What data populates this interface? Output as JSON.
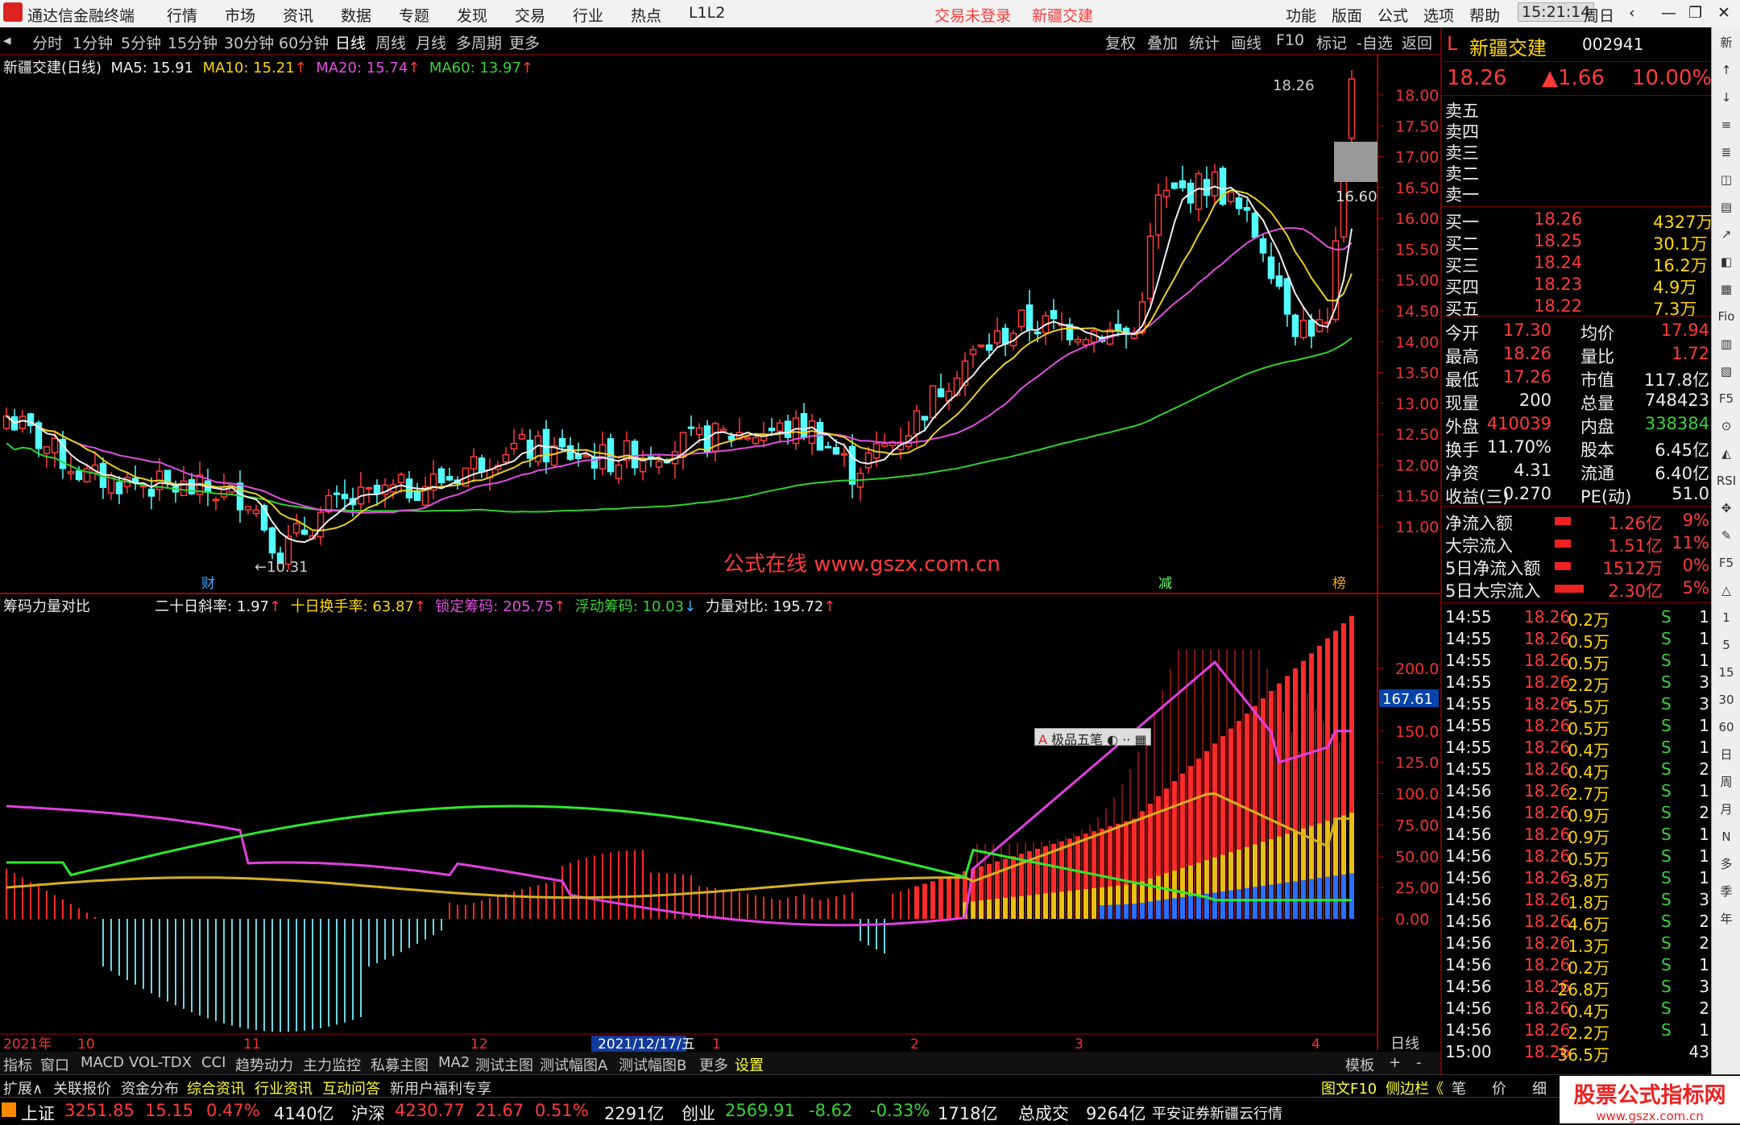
{
  "app": {
    "title": "通达信金融终端",
    "menus": [
      "行情",
      "市场",
      "资讯",
      "数据",
      "专题",
      "发现",
      "交易",
      "行业",
      "热点",
      "L1L2"
    ],
    "notice": [
      "交易未登录",
      "新疆交建"
    ],
    "right_menus": [
      "功能",
      "版面",
      "公式",
      "选项",
      "帮助"
    ],
    "time": "15:21:14",
    "weekday": "周日"
  },
  "periods": [
    "分时",
    "1分钟",
    "5分钟",
    "15分钟",
    "30分钟",
    "60分钟",
    "日线",
    "周线",
    "月线",
    "多周期",
    "更多"
  ],
  "tools": [
    "复权",
    "叠加",
    "统计",
    "画线",
    "F10",
    "标记",
    "-自选",
    "返回"
  ],
  "main_legend": {
    "name": "新疆交建(日线)",
    "ma5": "MA5: 15.91",
    "ma10": "MA10: 15.21",
    "ma20": "MA20: 15.74",
    "ma60": "MA60: 13.97"
  },
  "price_axis": [
    "18.00",
    "17.50",
    "17.00",
    "16.50",
    "16.00",
    "15.50",
    "15.00",
    "14.50",
    "14.00",
    "13.50",
    "13.00",
    "12.50",
    "12.00",
    "11.50",
    "11.00"
  ],
  "annotations": {
    "high": "18.26",
    "low": "10.31",
    "last_box": "16.60",
    "cai": "财",
    "jian": "减",
    "bang": "榜"
  },
  "watermark": "公式在线  www.gszx.com.cn",
  "sub_legend": {
    "name": "筹码力量对比",
    "k1": "二十日斜率: 1.97",
    "k2": "十日换手率: 63.87",
    "k3": "锁定筹码: 205.75",
    "k4": "浮动筹码: 10.03",
    "k5": "力量对比: 195.72"
  },
  "sub_axis": [
    "200.0",
    "175.0",
    "150.0",
    "125.0",
    "100.0",
    "75.00",
    "50.00",
    "25.00",
    "0.00"
  ],
  "sub_cursor": "167.61",
  "ime": "极品五笔",
  "x_axis": [
    "2021年",
    "10",
    "11",
    "12",
    "2021/12/17/五",
    "1",
    "2",
    "3",
    "4"
  ],
  "x_axis_right": "日线",
  "stock": {
    "name": "新疆交建",
    "code": "002941",
    "price": "18.26",
    "change": "▲1.66",
    "pct": "10.00%"
  },
  "asks": [
    "卖五",
    "卖四",
    "卖三",
    "卖二",
    "卖一"
  ],
  "bids": [
    {
      "l": "买一",
      "p": "18.26",
      "v": "4327万"
    },
    {
      "l": "买二",
      "p": "18.25",
      "v": "30.1万"
    },
    {
      "l": "买三",
      "p": "18.24",
      "v": "16.2万"
    },
    {
      "l": "买四",
      "p": "18.23",
      "v": "4.9万"
    },
    {
      "l": "买五",
      "p": "18.22",
      "v": "7.3万"
    }
  ],
  "stats": [
    {
      "a": "今开",
      "b": "17.30",
      "c": "均价",
      "d": "17.94"
    },
    {
      "a": "最高",
      "b": "18.26",
      "c": "量比",
      "d": "1.72"
    },
    {
      "a": "最低",
      "b": "17.26",
      "c": "市值",
      "d": "117.8亿"
    },
    {
      "a": "现量",
      "b": "200",
      "c": "总量",
      "d": "748423"
    },
    {
      "a": "外盘",
      "b": "410039",
      "c": "内盘",
      "d": "338384"
    },
    {
      "a": "换手",
      "b": "11.70%",
      "c": "股本",
      "d": "6.45亿"
    },
    {
      "a": "净资",
      "b": "4.31",
      "c": "流通",
      "d": "6.40亿"
    },
    {
      "a": "收益(三)",
      "b": "0.270",
      "c": "PE(动)",
      "d": "51.0"
    }
  ],
  "flows": [
    {
      "l": "净流入额",
      "v": "1.26亿",
      "p": "9%"
    },
    {
      "l": "大宗流入",
      "v": "1.51亿",
      "p": "11%"
    },
    {
      "l": "5日净流入额",
      "v": "1512万",
      "p": "0%"
    },
    {
      "l": "5日大宗流入",
      "v": "2.30亿",
      "p": "5%"
    }
  ],
  "ticks": [
    [
      "14:55",
      "18.26",
      "0.2万",
      "S",
      "1"
    ],
    [
      "14:55",
      "18.26",
      "0.5万",
      "S",
      "1"
    ],
    [
      "14:55",
      "18.26",
      "0.5万",
      "S",
      "1"
    ],
    [
      "14:55",
      "18.26",
      "2.2万",
      "S",
      "3"
    ],
    [
      "14:55",
      "18.26",
      "5.5万",
      "S",
      "3"
    ],
    [
      "14:55",
      "18.26",
      "0.5万",
      "S",
      "1"
    ],
    [
      "14:55",
      "18.26",
      "0.4万",
      "S",
      "1"
    ],
    [
      "14:55",
      "18.26",
      "0.4万",
      "S",
      "2"
    ],
    [
      "14:56",
      "18.26",
      "2.7万",
      "S",
      "1"
    ],
    [
      "14:56",
      "18.26",
      "0.9万",
      "S",
      "2"
    ],
    [
      "14:56",
      "18.26",
      "0.9万",
      "S",
      "1"
    ],
    [
      "14:56",
      "18.26",
      "0.5万",
      "S",
      "1"
    ],
    [
      "14:56",
      "18.26",
      "3.8万",
      "S",
      "1"
    ],
    [
      "14:56",
      "18.26",
      "1.8万",
      "S",
      "3"
    ],
    [
      "14:56",
      "18.26",
      "4.6万",
      "S",
      "2"
    ],
    [
      "14:56",
      "18.26",
      "1.3万",
      "S",
      "2"
    ],
    [
      "14:56",
      "18.26",
      "0.2万",
      "S",
      "1"
    ],
    [
      "14:56",
      "18.26",
      "26.8万",
      "S",
      "3"
    ],
    [
      "14:56",
      "18.26",
      "0.4万",
      "S",
      "2"
    ],
    [
      "14:56",
      "18.26",
      "2.2万",
      "S",
      "1"
    ],
    [
      "15:00",
      "18.26",
      "36.5万",
      "",
      "43"
    ]
  ],
  "bottom_tabs": [
    "指标",
    "窗口",
    "MACD",
    "VOL-TDX",
    "CCI",
    "趋势动力",
    "主力监控",
    "私募主图",
    "MA2",
    "测试主图",
    "测试幅图A",
    "测试幅图B",
    "更多",
    "设置"
  ],
  "bottom_right": [
    "模板",
    "+",
    "-"
  ],
  "status_tabs": [
    "扩展∧",
    "关联报价",
    "资金分布",
    "综合资讯",
    "行业资讯",
    "互动问答",
    "新用户福利专享"
  ],
  "status_right": [
    "图文F10",
    "侧边栏《",
    "笔",
    "价",
    "细",
    "势"
  ],
  "ticker": {
    "sh": "上证",
    "sh_v": "3251.85",
    "sh_c": "15.15",
    "sh_p": "0.47%",
    "sh_a": "4140亿",
    "hs": "沪深",
    "hs_v": "4230.77",
    "hs_c": "21.67",
    "hs_p": "0.51%",
    "hs_a": "2291亿",
    "cy": "创业",
    "cy_v": "2569.91",
    "cy_c": "-8.62",
    "cy_p": "-0.33%",
    "cy_a": "1718亿",
    "tot": "总成交",
    "tot_v": "9264亿",
    "src": "平安证券新疆云行情"
  },
  "brand": "股票公式指标网",
  "brand_url": "www.gszx.com.cn",
  "sidebar_icons": [
    "新",
    "↑",
    "↓",
    "≡",
    "≣",
    "◫",
    "▤",
    "↗",
    "◧",
    "▦",
    "Fio",
    "▥",
    "▧",
    "F5",
    "⊙",
    "◭",
    "RSI",
    "✥",
    "✎",
    "F5",
    "△",
    "1",
    "5",
    "15",
    "30",
    "60",
    "日",
    "周",
    "月",
    "N",
    "多",
    "季",
    "年"
  ]
}
